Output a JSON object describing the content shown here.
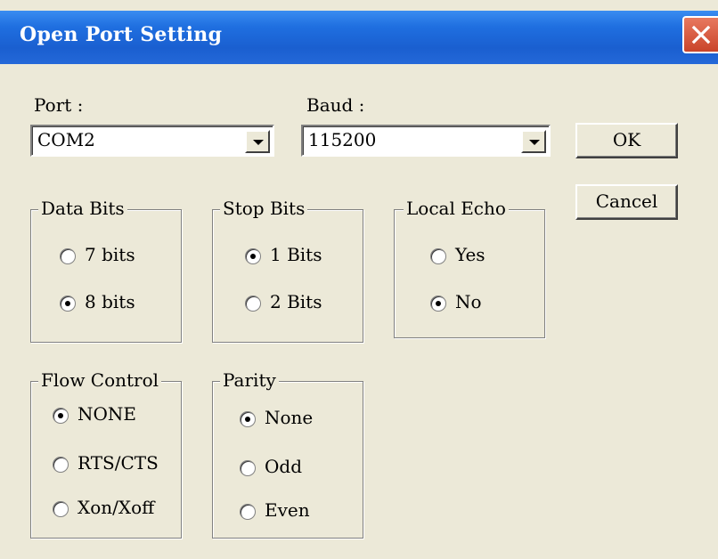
{
  "window": {
    "title": "Open Port Setting"
  },
  "port": {
    "label": "Port :",
    "value": "COM2"
  },
  "baud": {
    "label": "Baud :",
    "value": "115200"
  },
  "buttons": {
    "ok": "OK",
    "cancel": "Cancel"
  },
  "data_bits": {
    "title": "Data Bits",
    "options": [
      "7 bits",
      "8 bits"
    ],
    "selected": "8 bits"
  },
  "stop_bits": {
    "title": "Stop Bits",
    "options": [
      "1 Bits",
      "2 Bits"
    ],
    "selected": "1 Bits"
  },
  "local_echo": {
    "title": "Local Echo",
    "options": [
      "Yes",
      "No"
    ],
    "selected": "No"
  },
  "flow_control": {
    "title": "Flow Control",
    "options": [
      "NONE",
      "RTS/CTS",
      "Xon/Xoff"
    ],
    "selected": "NONE"
  },
  "parity": {
    "title": "Parity",
    "options": [
      "None",
      "Odd",
      "Even"
    ],
    "selected": "None"
  },
  "icons": {
    "close": "close-icon",
    "dropdown": "chevron-down-icon"
  }
}
